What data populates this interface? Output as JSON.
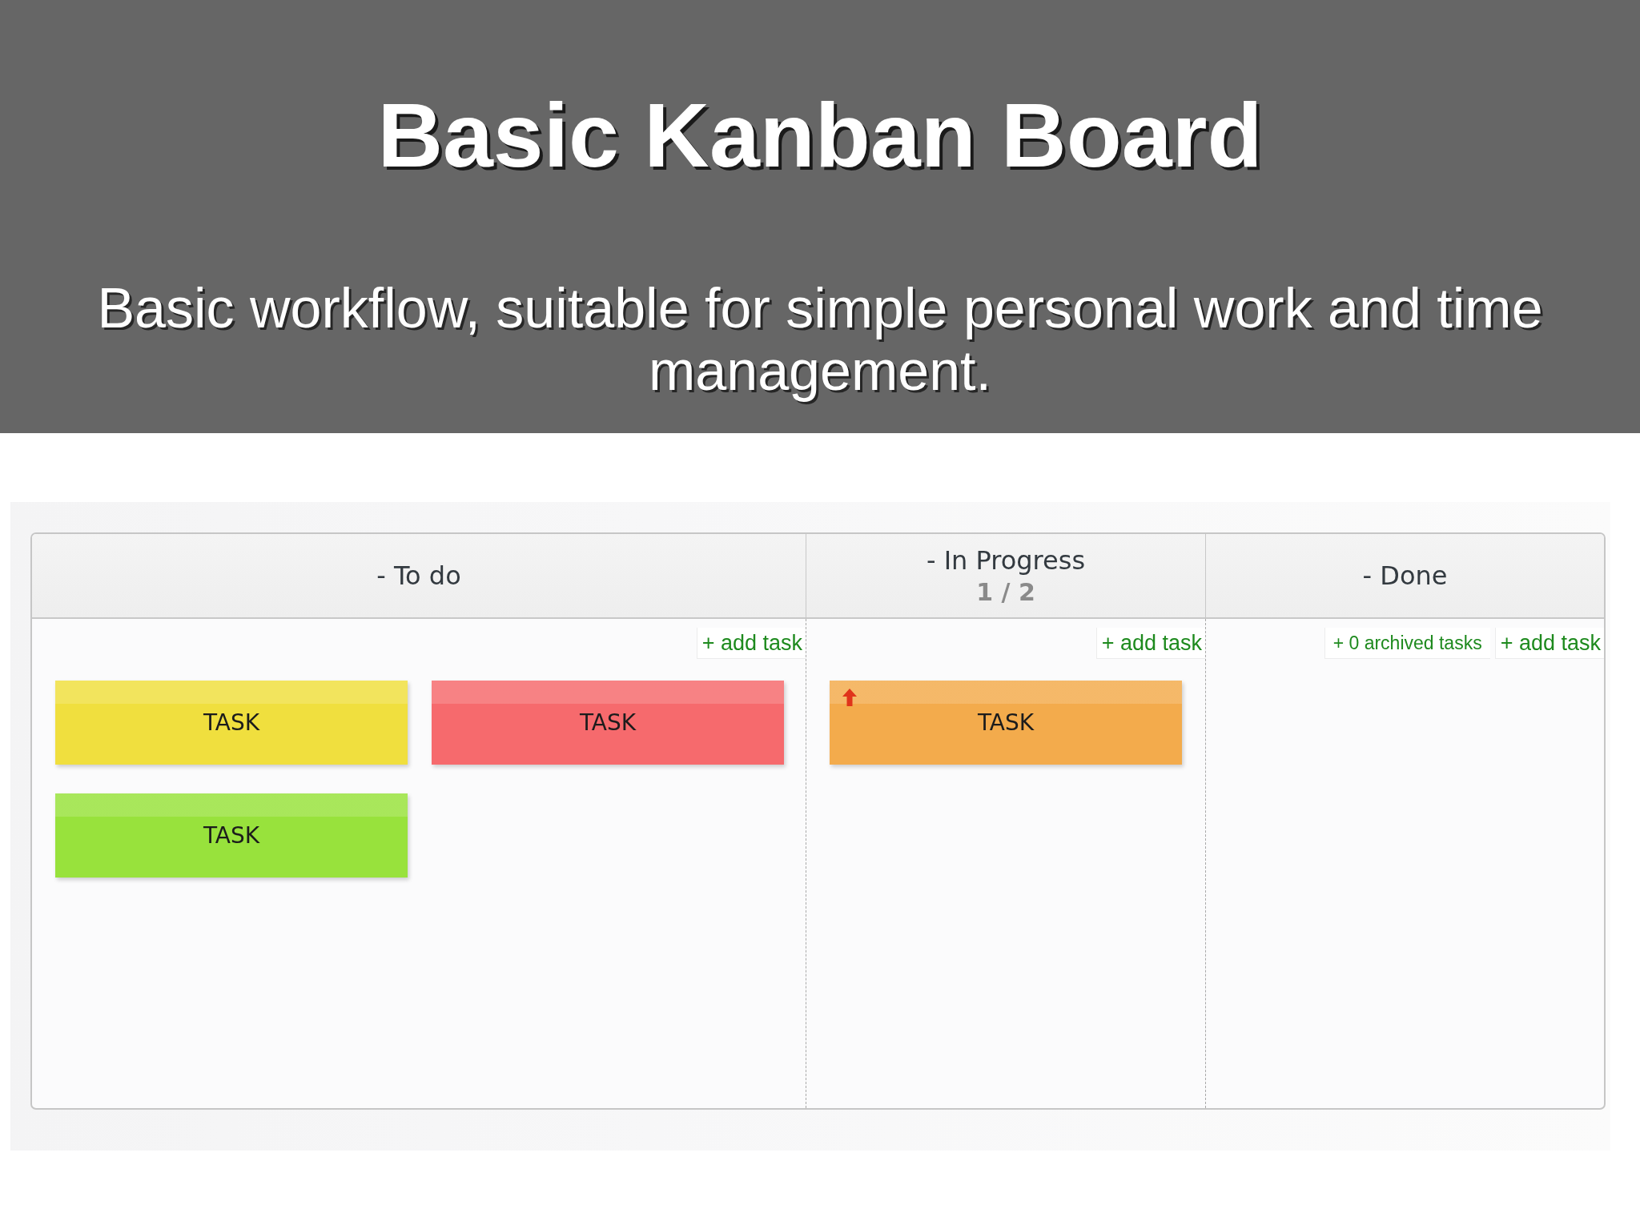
{
  "slide": {
    "title": "Basic Kanban Board",
    "subtitle": "Basic workflow, suitable for simple personal work and time management."
  },
  "board": {
    "columns": [
      {
        "title": "- To do",
        "actions": [
          {
            "kind": "add",
            "label": "+ add task"
          }
        ],
        "tasks": [
          {
            "label": "TASK",
            "color": "#f0df3e",
            "high_priority": false
          },
          {
            "label": "TASK",
            "color": "#f66a6d",
            "high_priority": false
          },
          {
            "label": "TASK",
            "color": "#98e23c",
            "high_priority": false
          }
        ]
      },
      {
        "title": "- In Progress",
        "wip_limit": "1 / 2",
        "actions": [
          {
            "kind": "add",
            "label": "+ add task"
          }
        ],
        "tasks": [
          {
            "label": "TASK",
            "color": "#f3ab4c",
            "high_priority": true
          }
        ]
      },
      {
        "title": "- Done",
        "actions": [
          {
            "kind": "archived",
            "label": "+ 0 archived tasks"
          },
          {
            "kind": "add",
            "label": "+ add task"
          }
        ]
      }
    ]
  }
}
